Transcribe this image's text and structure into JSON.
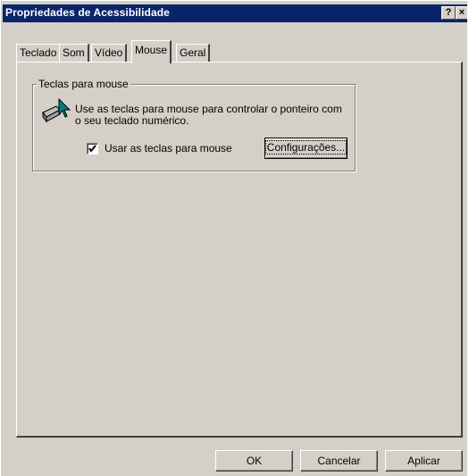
{
  "window": {
    "title": "Propriedades de Acessibilidade",
    "help_label": "?",
    "close_label": "×"
  },
  "tabs": [
    {
      "label": "Teclado",
      "active": false
    },
    {
      "label": "Som",
      "active": false
    },
    {
      "label": "Vídeo",
      "active": false
    },
    {
      "label": "Mouse",
      "active": true
    },
    {
      "label": "Geral",
      "active": false
    }
  ],
  "mouse_keys": {
    "group_title": "Teclas para mouse",
    "description": "Use as teclas para mouse para controlar o ponteiro com o seu teclado numérico.",
    "checkbox_label": "Usar as teclas para mouse",
    "checkbox_checked": true,
    "check_mark": "✓",
    "settings_button": "Configurações...",
    "icon": "mouse-keys-icon"
  },
  "footer": {
    "ok": "OK",
    "cancel": "Cancelar",
    "apply": "Aplicar"
  }
}
